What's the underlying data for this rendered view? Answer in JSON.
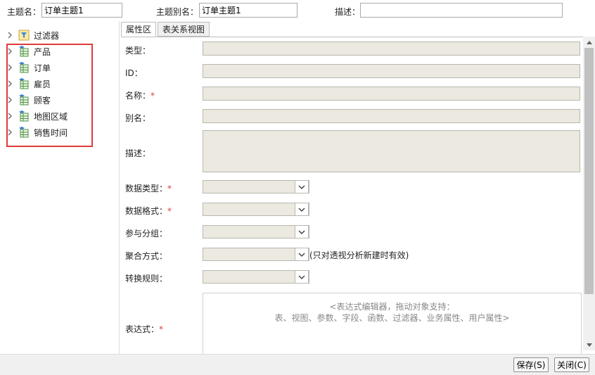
{
  "header": {
    "topic_name_label": "主题名：",
    "topic_name_value": "订单主题1",
    "topic_alias_label": "主题别名：",
    "topic_alias_value": "订单主题1",
    "description_label": "描述：",
    "description_value": ""
  },
  "tree": {
    "items": [
      {
        "label": "过滤器",
        "icon": "filter-icon"
      },
      {
        "label": "产品",
        "icon": "table-icon"
      },
      {
        "label": "订单",
        "icon": "table-icon"
      },
      {
        "label": "雇员",
        "icon": "table-icon"
      },
      {
        "label": "顾客",
        "icon": "table-icon"
      },
      {
        "label": "地图区域",
        "icon": "table-icon"
      },
      {
        "label": "销售时间",
        "icon": "table-icon"
      }
    ]
  },
  "tabs": [
    {
      "label": "属性区",
      "active": true
    },
    {
      "label": "表关系视图",
      "active": false
    }
  ],
  "form": {
    "type_label": "类型：",
    "id_label": "ID：",
    "name_label": "名称：",
    "alias_label": "别名：",
    "desc_label": "描述：",
    "datatype_label": "数据类型：",
    "dataformat_label": "数据格式：",
    "grouping_label": "参与分组：",
    "aggregation_label": "聚合方式：",
    "aggregation_hint": "(只对透视分析新建时有效)",
    "conversion_label": "转换规则：",
    "expression_label": "表达式：",
    "required_mark": "*",
    "expression_hint_line1": "<表达式编辑器，拖动对象支持：",
    "expression_hint_line2": "表、视图、参数、字段、函数、过滤器、业务属性、用户属性>"
  },
  "footer": {
    "save_label": "保存(S)",
    "close_label": "关闭(C)"
  },
  "colors": {
    "highlight": "#e03b3b",
    "field_bg": "#ebe9e0",
    "required": "#e03b3b"
  }
}
